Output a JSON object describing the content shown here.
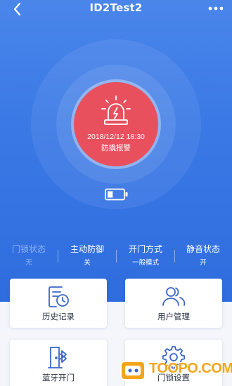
{
  "nav": {
    "title": "ID2Test2",
    "back_icon": "chevron-left-icon",
    "more_icon": "more-dots-icon"
  },
  "alarm": {
    "time": "2018/12/12 18:30",
    "label": "防撬报警",
    "icon": "siren-icon",
    "color": "#e8505e"
  },
  "battery": {
    "icon": "battery-icon",
    "level": 0.35
  },
  "status": [
    {
      "title": "门锁状态",
      "value": "无",
      "dim": true
    },
    {
      "title": "主动防御",
      "value": "关",
      "dim": false
    },
    {
      "title": "开门方式",
      "value": "一般模式",
      "dim": false
    },
    {
      "title": "静音状态",
      "value": "开",
      "dim": false
    }
  ],
  "cards": [
    {
      "label": "历史记录",
      "icon": "history-icon"
    },
    {
      "label": "用户管理",
      "icon": "users-icon"
    },
    {
      "label": "蓝牙开门",
      "icon": "bluetooth-door-icon"
    },
    {
      "label": "门锁设置",
      "icon": "gear-icon"
    }
  ],
  "watermark": {
    "text": "TOOPO.COM"
  },
  "colors": {
    "primary": "#3b79e6",
    "accent": "#e8505e",
    "card_icon": "#3a66c8"
  }
}
